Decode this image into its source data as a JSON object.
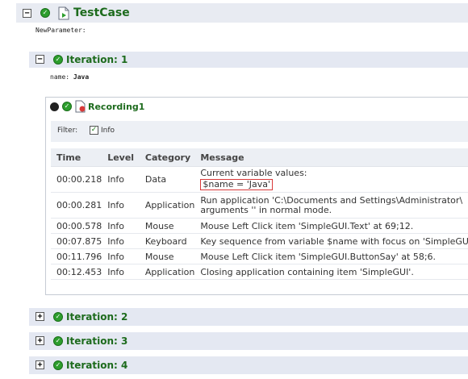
{
  "testcase": {
    "title": "TestCase",
    "param_label": "NewParameter:"
  },
  "iteration1": {
    "title": "Iteration: 1",
    "param_label": "name:",
    "param_value": "Java"
  },
  "recording": {
    "title": "Recording1",
    "filter_label": "Filter:",
    "filter_option": "Info",
    "columns": [
      "Time",
      "Level",
      "Category",
      "Message"
    ],
    "rows": [
      {
        "time": "00:00.218",
        "level": "Info",
        "category": "Data",
        "message_line1": "Current variable values:",
        "message_highlight": "$name = 'Java'"
      },
      {
        "time": "00:00.281",
        "level": "Info",
        "category": "Application",
        "message_line1": "Run application 'C:\\Documents and Settings\\Administrator\\",
        "message_line2": "arguments '' in normal mode."
      },
      {
        "time": "00:00.578",
        "level": "Info",
        "category": "Mouse",
        "message_line1": "Mouse Left Click item 'SimpleGUI.Text' at 69;12."
      },
      {
        "time": "00:07.875",
        "level": "Info",
        "category": "Keyboard",
        "message_line1": "Key sequence from variable $name with focus on 'SimpleGU"
      },
      {
        "time": "00:11.796",
        "level": "Info",
        "category": "Mouse",
        "message_line1": "Mouse Left Click item 'SimpleGUI.ButtonSay' at 58;6."
      },
      {
        "time": "00:12.453",
        "level": "Info",
        "category": "Application",
        "message_line1": "Closing application containing item 'SimpleGUI'."
      }
    ]
  },
  "iterations_collapsed": [
    "Iteration: 2",
    "Iteration: 3",
    "Iteration: 4"
  ],
  "symbols": {
    "minus": "−",
    "plus": "+",
    "check": "✓"
  },
  "colors": {
    "pass_green": "#2d9e2d",
    "title_green": "#1d6b1d",
    "highlight_red": "#d83a3a"
  }
}
